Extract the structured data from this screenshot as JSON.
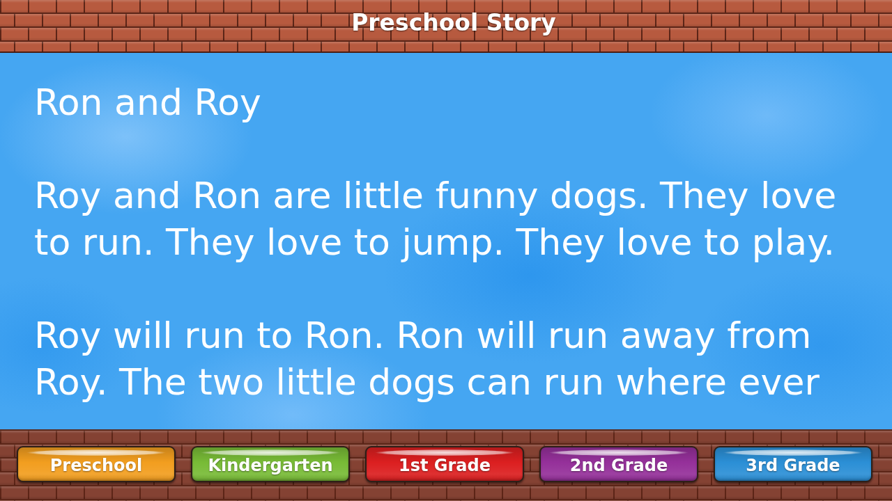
{
  "title_bar": {
    "title": "Preschool Story"
  },
  "story": {
    "title": "Ron and Roy",
    "paragraphs": [
      "Roy and Ron are little funny dogs. They love to run. They love to jump. They love to play.",
      "Roy will run to Ron. Ron will run away from Roy. The two little dogs can run where ever"
    ]
  },
  "grade_buttons": [
    {
      "label": "Preschool",
      "color": "#f29e1f"
    },
    {
      "label": "Kindergarten",
      "color": "#78bb36"
    },
    {
      "label": "1st Grade",
      "color": "#dc1f20"
    },
    {
      "label": "2nd Grade",
      "color": "#95309a"
    },
    {
      "label": "3rd Grade",
      "color": "#2b8fd6"
    }
  ]
}
